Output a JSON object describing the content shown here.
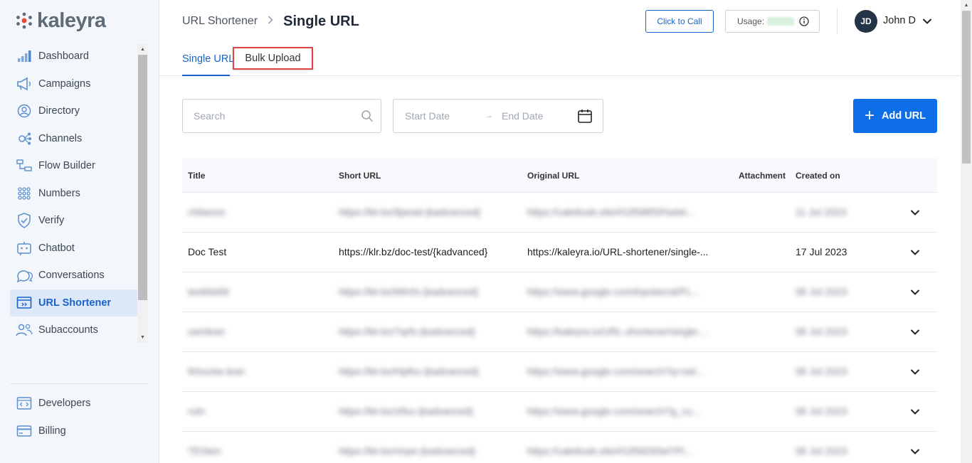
{
  "brand": {
    "name": "kaleyra"
  },
  "sidebar": {
    "items": [
      {
        "label": "Dashboard",
        "icon": "bar-chart-icon"
      },
      {
        "label": "Campaigns",
        "icon": "megaphone-icon"
      },
      {
        "label": "Directory",
        "icon": "contact-icon"
      },
      {
        "label": "Channels",
        "icon": "channels-icon"
      },
      {
        "label": "Flow Builder",
        "icon": "flow-icon"
      },
      {
        "label": "Numbers",
        "icon": "dial-grid-icon"
      },
      {
        "label": "Verify",
        "icon": "shield-check-icon"
      },
      {
        "label": "Chatbot",
        "icon": "chatbot-icon"
      },
      {
        "label": "Conversations",
        "icon": "chat-bubbles-icon"
      },
      {
        "label": "URL Shortener",
        "icon": "link-icon",
        "active": true
      },
      {
        "label": "Subaccounts",
        "icon": "users-icon"
      }
    ],
    "bottom_items": [
      {
        "label": "Developers",
        "icon": "code-icon"
      },
      {
        "label": "Billing",
        "icon": "card-icon"
      }
    ]
  },
  "header": {
    "breadcrumb_parent": "URL Shortener",
    "page_title": "Single URL",
    "click_to_call_label": "Click to Call",
    "usage_label": "Usage:",
    "user": {
      "initials": "JD",
      "name": "John D"
    }
  },
  "tabs": {
    "single": "Single URL",
    "bulk": "Bulk Upload"
  },
  "toolbar": {
    "search_placeholder": "Search",
    "start_date_placeholder": "Start Date",
    "end_date_placeholder": "End Date",
    "add_url_label": "Add URL"
  },
  "table": {
    "columns": [
      "Title",
      "Short URL",
      "Original URL",
      "Attachment",
      "Created on"
    ],
    "rows": [
      {
        "title": "chitanon",
        "short_url": "https://klr.bz/8pead-{kadvanced}",
        "original_url": "https://caleltusb.site/#1958859%elel...",
        "attachment": "",
        "created": "11 Jul 2023",
        "blurred": true
      },
      {
        "title": "Doc Test",
        "short_url": "https://klr.bz/doc-test/{kadvanced}",
        "original_url": "https://kaleyra.io/URL-shortener/single-...",
        "attachment": "",
        "created": "17 Jul 2023",
        "blurred": false
      },
      {
        "title": "testMalW",
        "short_url": "https://klr.bz/Mhrfo-{kadvanced}",
        "original_url": "https://www.google.com/topsterral/PL...",
        "attachment": "",
        "created": "06 Jul 2023",
        "blurred": true
      },
      {
        "title": "ownlean",
        "short_url": "https://klr.bz/7qrfs-{kadvanced}",
        "original_url": "https://kaleyra.io/URL-shortener/single-...",
        "attachment": "",
        "created": "06 Jul 2023",
        "blurred": true
      },
      {
        "title": "firtvunta lean",
        "short_url": "https://klr.bz/Hplho-{kadvanced}",
        "original_url": "https://www.google.com/search?q=net...",
        "attachment": "",
        "created": "06 Jul 2023",
        "blurred": true
      },
      {
        "title": "rutn",
        "short_url": "https://klr.bz/zlfxo-{kadvanced}",
        "original_url": "https://www.google.com/search?g_cu...",
        "attachment": "",
        "created": "06 Jul 2023",
        "blurred": true
      },
      {
        "title": "TESten",
        "short_url": "https://klr.bz/mrpe-{kadvanced}",
        "original_url": "https://caleltusb.site/#1958265el7Pl...",
        "attachment": "",
        "created": "06 Jul 2023",
        "blurred": true
      }
    ]
  },
  "colors": {
    "accent": "#1a64c8",
    "primary_button": "#0d6ee8",
    "highlight_border": "#e04545",
    "sidebar_bg": "#f3f7fc"
  }
}
